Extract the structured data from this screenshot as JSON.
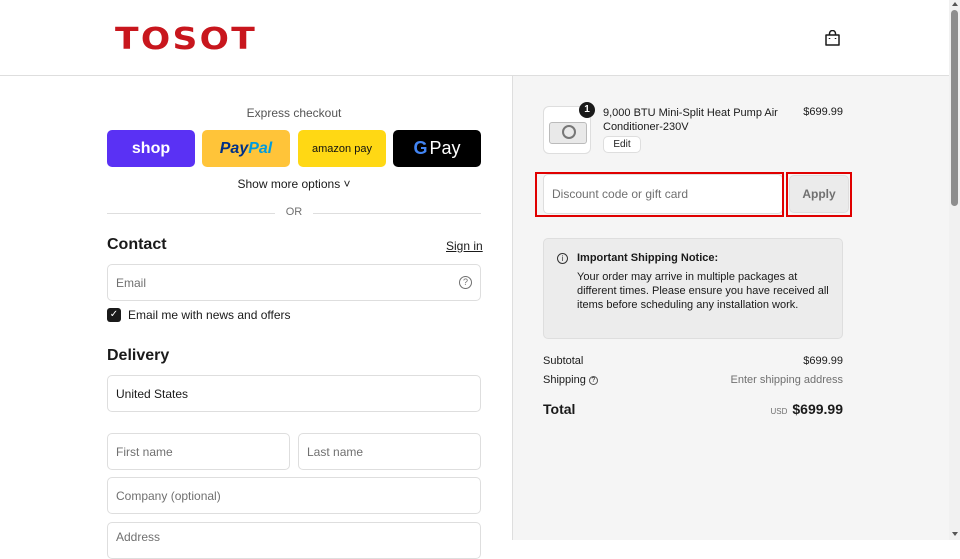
{
  "header": {
    "logo_text": "TOSOT",
    "brand_color": "#c8161d",
    "cart_icon": "shopping-bag-icon"
  },
  "express": {
    "title": "Express checkout",
    "buttons": {
      "shop": "shop",
      "paypal_a": "Pay",
      "paypal_b": "Pal",
      "amazon": "amazon pay",
      "gpay_g": "G",
      "gpay_text": "Pay"
    },
    "show_more": "Show more options ˅",
    "or_text": "OR"
  },
  "contact": {
    "title": "Contact",
    "sign_in": "Sign in",
    "email_placeholder": "Email",
    "newsletter_label": "Email me with news and offers",
    "newsletter_checked": true
  },
  "delivery": {
    "title": "Delivery",
    "country": "United States",
    "first_name_placeholder": "First name",
    "last_name_placeholder": "Last name",
    "company_placeholder": "Company (optional)",
    "address_placeholder": "Address"
  },
  "order": {
    "quantity": "1",
    "product_name": "9,000 BTU Mini-Split Heat Pump Air Conditioner-230V",
    "product_price": "$699.99",
    "edit_label": "Edit",
    "discount_placeholder": "Discount code or gift card",
    "apply_label": "Apply",
    "notice_title": "Important Shipping Notice:",
    "notice_body": "Your order may arrive in multiple packages at different times. Please ensure you have received all items before scheduling any installation work.",
    "subtotal_label": "Subtotal",
    "subtotal_value": "$699.99",
    "shipping_label": "Shipping",
    "shipping_value": "Enter shipping address",
    "total_label": "Total",
    "currency": "USD",
    "total_value": "$699.99"
  }
}
